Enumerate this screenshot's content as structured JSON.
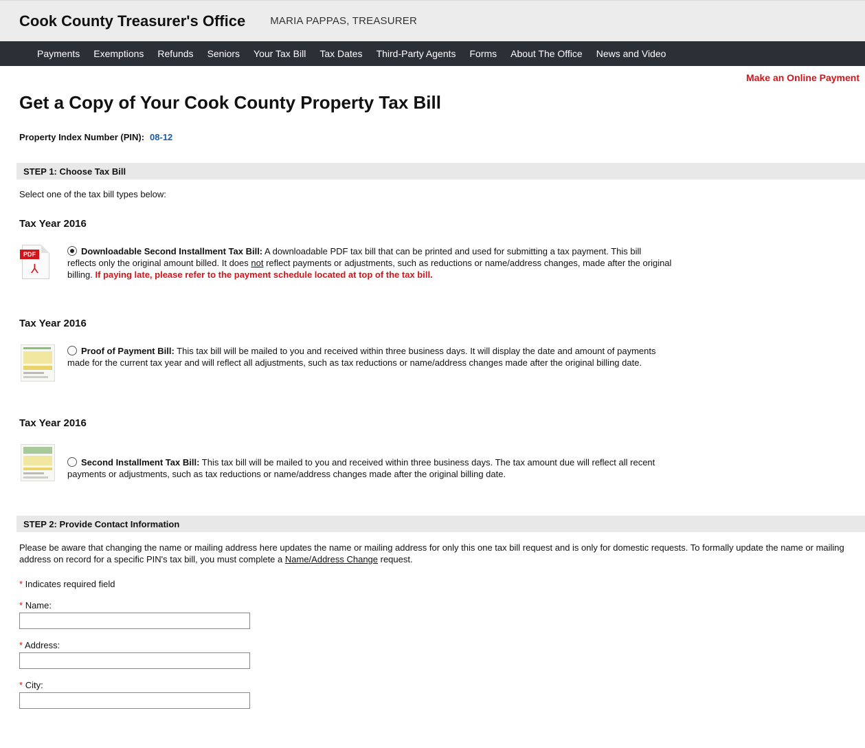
{
  "header": {
    "title": "Cook County Treasurer's Office",
    "subtitle": "MARIA PAPPAS, TREASURER"
  },
  "nav": {
    "items": [
      "Payments",
      "Exemptions",
      "Refunds",
      "Seniors",
      "Your Tax Bill",
      "Tax Dates",
      "Third-Party Agents",
      "Forms",
      "About The Office",
      "News and Video"
    ]
  },
  "pay_link": "Make an Online Payment",
  "page_title": "Get a Copy of Your Cook County Property Tax Bill",
  "pin": {
    "label": "Property Index Number (PIN):",
    "value": "08-12"
  },
  "step1": {
    "label": "STEP 1:  Choose Tax Bill",
    "instructions": "Select one of the tax bill types below:",
    "options": [
      {
        "tax_year": "Tax Year 2016",
        "icon": "pdf-icon",
        "selected": true,
        "title": "Downloadable Second Installment Tax Bill:",
        "desc_a": " A downloadable PDF tax bill that can be printed and used for submitting a tax payment. This bill reflects only the original amount billed. It does ",
        "desc_not": "not",
        "desc_b": " reflect payments or adjustments, such as reductions or name/address changes, made after the original billing. ",
        "late_note": "If paying late, please refer to the payment schedule located at top of the tax bill."
      },
      {
        "tax_year": "Tax Year 2016",
        "icon": "bill-thumbnail-icon",
        "selected": false,
        "title": "Proof of Payment Bill:",
        "desc": " This tax bill will be mailed to you and received within three business days. It will display the date and amount of payments made for the current tax year and will reflect all adjustments, such as tax reductions or name/address changes made after the original billing date."
      },
      {
        "tax_year": "Tax Year 2016",
        "icon": "bill-thumbnail-icon",
        "selected": false,
        "title": "Second Installment Tax Bill:",
        "desc": " This tax bill will be mailed to you and received within three business days. The tax amount due will reflect all recent payments or adjustments, such as tax reductions or name/address changes made after the original billing date."
      }
    ]
  },
  "step2": {
    "label": "STEP 2:  Provide Contact Information",
    "notice_a": "Please be aware that changing the name or mailing address here updates the name or mailing address for only this one tax bill request and is only for domestic requests. To formally update the name or mailing address on record for a specific PIN's tax bill, you must complete a ",
    "notice_link": "Name/Address Change",
    "notice_b": " request.",
    "required_marker": "*",
    "required_note": " Indicates required field",
    "fields": [
      {
        "label": "Name:",
        "value": ""
      },
      {
        "label": "Address:",
        "value": ""
      },
      {
        "label": "City:",
        "value": ""
      }
    ]
  },
  "colors": {
    "nav_bg": "#2b3037",
    "header_bg": "#ececec",
    "accent_red": "#d0151b",
    "pin_blue": "#1a5aa8",
    "step_bar_bg": "#e8e8e8"
  }
}
